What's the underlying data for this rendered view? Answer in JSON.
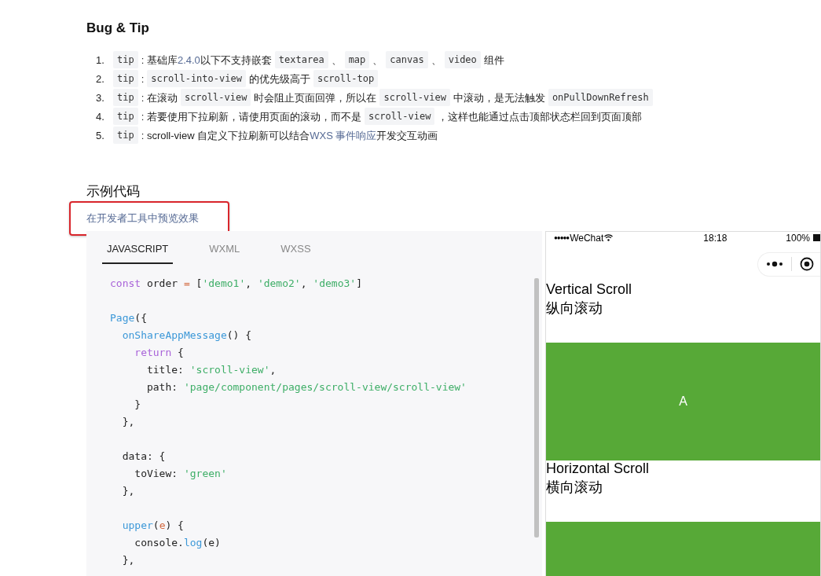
{
  "bug_tip": {
    "title": "Bug & Tip",
    "items": [
      {
        "number": "1.",
        "segments": [
          {
            "kind": "code",
            "text": "tip"
          },
          {
            "kind": "text",
            "text": ": 基础库 "
          },
          {
            "kind": "link",
            "text": "2.4.0"
          },
          {
            "kind": "text",
            "text": "以下不支持嵌套"
          },
          {
            "kind": "code",
            "text": "textarea"
          },
          {
            "kind": "text",
            "text": "、"
          },
          {
            "kind": "code",
            "text": "map"
          },
          {
            "kind": "text",
            "text": "、"
          },
          {
            "kind": "code",
            "text": "canvas"
          },
          {
            "kind": "text",
            "text": "、"
          },
          {
            "kind": "code",
            "text": "video"
          },
          {
            "kind": "text",
            "text": "组件"
          }
        ]
      },
      {
        "number": "2.",
        "segments": [
          {
            "kind": "code",
            "text": "tip"
          },
          {
            "kind": "text",
            "text": ": "
          },
          {
            "kind": "code",
            "text": "scroll-into-view"
          },
          {
            "kind": "text",
            "text": "的优先级高于"
          },
          {
            "kind": "code",
            "text": "scroll-top"
          }
        ]
      },
      {
        "number": "3.",
        "segments": [
          {
            "kind": "code",
            "text": "tip"
          },
          {
            "kind": "text",
            "text": ": 在滚动"
          },
          {
            "kind": "code",
            "text": "scroll-view"
          },
          {
            "kind": "text",
            "text": "时会阻止页面回弹，所以在"
          },
          {
            "kind": "code",
            "text": "scroll-view"
          },
          {
            "kind": "text",
            "text": "中滚动，是无法触发"
          },
          {
            "kind": "code",
            "text": "onPullDownRefresh"
          }
        ]
      },
      {
        "number": "4.",
        "segments": [
          {
            "kind": "code",
            "text": "tip"
          },
          {
            "kind": "text",
            "text": ": 若要使用下拉刷新，请使用页面的滚动，而不是"
          },
          {
            "kind": "code",
            "text": "scroll-view"
          },
          {
            "kind": "text",
            "text": "，这样也能通过点击顶部状态栏回到页面顶部"
          }
        ]
      },
      {
        "number": "5.",
        "segments": [
          {
            "kind": "code",
            "text": "tip"
          },
          {
            "kind": "text",
            "text": ": scroll-view 自定义下拉刷新可以结合 "
          },
          {
            "kind": "link",
            "text": "WXS 事件响应"
          },
          {
            "kind": "text",
            "text": " 开发交互动画"
          }
        ]
      }
    ]
  },
  "example": {
    "title": "示例代码",
    "preview_link": "在开发者工具中预览效果",
    "tabs": [
      {
        "label": "JAVASCRIPT",
        "selected": true
      },
      {
        "label": "WXML",
        "selected": false
      },
      {
        "label": "WXSS",
        "selected": false
      }
    ],
    "code_blocks": [
      [
        [
          {
            "kind": "keyword",
            "text": "const"
          },
          {
            "kind": "plain",
            "text": " order "
          },
          {
            "kind": "operator",
            "text": "="
          },
          {
            "kind": "plain",
            "text": " ["
          },
          {
            "kind": "string",
            "text": "'demo1'"
          },
          {
            "kind": "plain",
            "text": ", "
          },
          {
            "kind": "string",
            "text": "'demo2'"
          },
          {
            "kind": "plain",
            "text": ", "
          },
          {
            "kind": "string",
            "text": "'demo3'"
          },
          {
            "kind": "plain",
            "text": "]"
          }
        ]
      ],
      [
        [
          {
            "kind": "function",
            "text": "Page"
          },
          {
            "kind": "plain",
            "text": "({"
          }
        ],
        [
          {
            "kind": "function",
            "text": "  onShareAppMessage"
          },
          {
            "kind": "plain",
            "text": "() {"
          }
        ],
        [
          {
            "kind": "keyword",
            "text": "    return"
          },
          {
            "kind": "plain",
            "text": " {"
          }
        ],
        [
          {
            "kind": "plain",
            "text": "      title: "
          },
          {
            "kind": "string",
            "text": "'scroll-view'"
          },
          {
            "kind": "plain",
            "text": ","
          }
        ],
        [
          {
            "kind": "plain",
            "text": "      path: "
          },
          {
            "kind": "string",
            "text": "'page/component/pages/scroll-view/scroll-view'"
          }
        ],
        [
          {
            "kind": "plain",
            "text": "    }"
          }
        ],
        [
          {
            "kind": "plain",
            "text": "  },"
          }
        ]
      ],
      [
        [
          {
            "kind": "plain",
            "text": "  data: {"
          }
        ],
        [
          {
            "kind": "plain",
            "text": "    toView: "
          },
          {
            "kind": "string",
            "text": "'green'"
          }
        ],
        [
          {
            "kind": "plain",
            "text": "  },"
          }
        ]
      ],
      [
        [
          {
            "kind": "function",
            "text": "  upper"
          },
          {
            "kind": "plain",
            "text": "("
          },
          {
            "kind": "param",
            "text": "e"
          },
          {
            "kind": "plain",
            "text": ") {"
          }
        ],
        [
          {
            "kind": "plain",
            "text": "    console."
          },
          {
            "kind": "function",
            "text": "log"
          },
          {
            "kind": "plain",
            "text": "(e)"
          }
        ],
        [
          {
            "kind": "plain",
            "text": "  },"
          }
        ]
      ]
    ]
  },
  "phone_preview": {
    "status_bar": {
      "signal": "●●●●●",
      "carrier": "WeChat",
      "time": "18:18",
      "battery": "100%"
    },
    "sections": [
      {
        "title": "Vertical Scroll",
        "subtitle": "纵向滚动",
        "block_label": "A",
        "color": "#57a937"
      },
      {
        "title": "Horizontal Scroll",
        "subtitle": "横向滚动",
        "color": "#57a937"
      }
    ]
  }
}
